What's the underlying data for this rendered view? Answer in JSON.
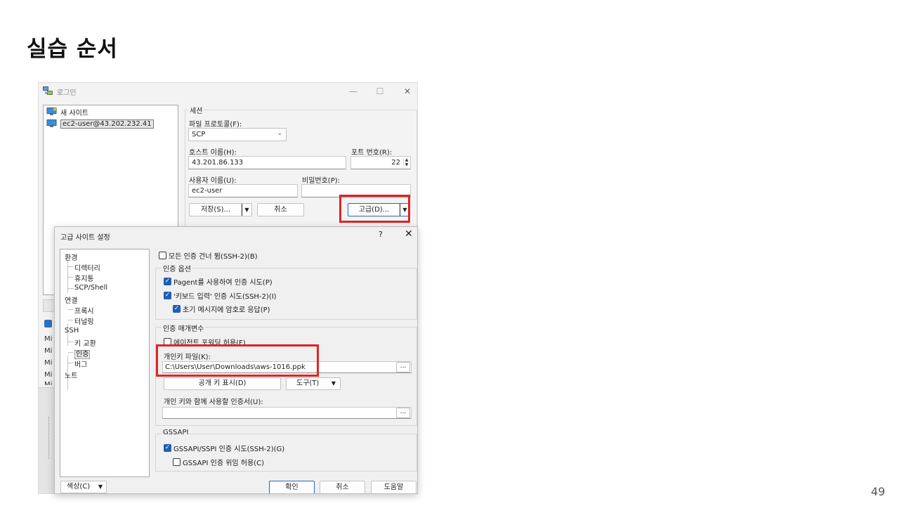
{
  "slide": {
    "title": "실습 순서",
    "page_number": "49"
  },
  "login_window": {
    "title": "로그인",
    "window_buttons": {
      "minimize": "—",
      "maximize": "☐",
      "close": "✕"
    },
    "sites": [
      {
        "label": "새 사이트",
        "icon": "new-site-computer-icon"
      },
      {
        "label": "ec2-user@43.202.232.41",
        "icon": "saved-site-computer-icon",
        "selected": true
      }
    ],
    "background_list": [
      "Mi",
      "Mi",
      "Mi",
      "Mi",
      "Mi"
    ],
    "session": {
      "group_label": "세션",
      "protocol_label": "파일 프로토콜(F):",
      "protocol_value": "SCP",
      "host_label": "호스트 이름(H):",
      "host_value": "43.201.86.133",
      "port_label": "포트 번호(R):",
      "port_value": "22",
      "user_label": "사용자 이름(U):",
      "user_value": "ec2-user",
      "password_label": "비밀번호(P):",
      "password_value": "",
      "save_button": "저장(S)...",
      "cancel_button": "취소",
      "advanced_button": "고급(D)..."
    }
  },
  "advanced_dialog": {
    "title": "고급 사이트 설정",
    "help_label": "?",
    "close_label": "✕",
    "nav": [
      {
        "label": "환경",
        "level": 0
      },
      {
        "label": "디렉터리",
        "level": 1
      },
      {
        "label": "휴지통",
        "level": 1
      },
      {
        "label": "SCP/Shell",
        "level": 1
      },
      {
        "label": "연결",
        "level": 0
      },
      {
        "label": "프록시",
        "level": 1
      },
      {
        "label": "터널링",
        "level": 1
      },
      {
        "label": "SSH",
        "level": 0
      },
      {
        "label": "키 교환",
        "level": 1
      },
      {
        "label": "인증",
        "level": 1,
        "selected": true
      },
      {
        "label": "버그",
        "level": 1
      },
      {
        "label": "노트",
        "level": 0
      }
    ],
    "skip_auth": {
      "label": "모든 인증 건너 뜀(SSH-2)(B)",
      "checked": false
    },
    "auth_options": {
      "group_label": "인증 옵션",
      "pagent": {
        "label": "Pagent를 사용하여 인증 시도(P)",
        "checked": true
      },
      "keyboard": {
        "label": "'키보드 입력' 인증 시도(SSH-2)(I)",
        "checked": true
      },
      "respond": {
        "label": "초기 메시지에 암호로 응답(P)",
        "checked": true
      }
    },
    "auth_params": {
      "group_label": "인증 매개변수",
      "agent_forward": {
        "label": "에이전트 포워딩 허용(F)",
        "checked": false
      },
      "private_key_label": "개인키 파일(K):",
      "private_key_value": "C:\\Users\\User\\Downloads\\aws-1016.ppk",
      "browse_label": "...",
      "show_public_key_button": "공개 키 표시(D)",
      "tools_button": "도구(T)",
      "certificate_label": "개인 키와 함께 사용할 인증서(U):",
      "certificate_value": "",
      "certificate_browse_label": "..."
    },
    "gssapi": {
      "group_label": "GSSAPI",
      "attempt": {
        "label": "GSSAPI/SSPI 인증 시도(SSH-2)(G)",
        "checked": true
      },
      "delegation": {
        "label": "GSSAPI 인증 위임 허용(C)",
        "checked": false
      }
    },
    "footer": {
      "color_button": "색상(C)",
      "ok_button": "확인",
      "cancel_button": "취소",
      "help_button": "도움말"
    }
  },
  "highlight_color": "#e02424",
  "checkbox_color": "#1f5fb8"
}
